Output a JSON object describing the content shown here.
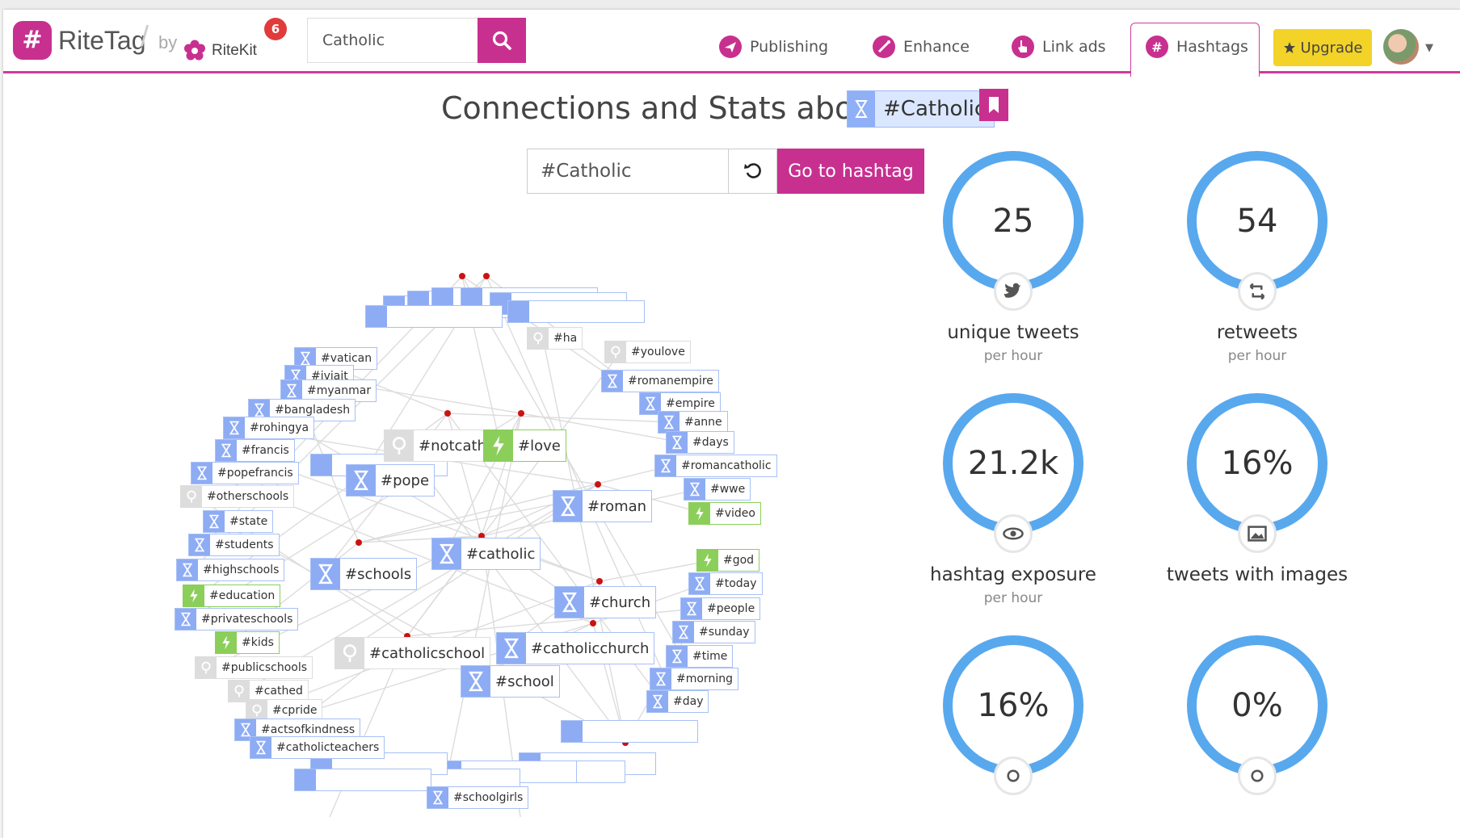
{
  "header": {
    "logo_mark": "#",
    "app_name": "RiteTag",
    "by_label": "by",
    "parent_name": "RiteKit",
    "notification_count": "6",
    "search_value": "Catholic",
    "nav": [
      {
        "label": "Publishing",
        "icon": "paper-plane-icon"
      },
      {
        "label": "Enhance",
        "icon": "magic-wand-icon"
      },
      {
        "label": "Link ads",
        "icon": "pointer-icon"
      },
      {
        "label": "Hashtags",
        "icon": "hashtag-icon",
        "active": true
      }
    ],
    "upgrade_label": "Upgrade",
    "brand_color": "#c8308f"
  },
  "page": {
    "title": "Connections and Stats about",
    "hashtag": "#Catholic",
    "input_value": "#Catholic",
    "go_label": "Go to hashtag"
  },
  "graph": {
    "nodes": [
      {
        "label": "#vatican",
        "kind": "blue"
      },
      {
        "label": "#iviait",
        "kind": "blue"
      },
      {
        "label": "#myanmar",
        "kind": "blue"
      },
      {
        "label": "#bangladesh",
        "kind": "blue"
      },
      {
        "label": "#rohingya",
        "kind": "blue"
      },
      {
        "label": "#francis",
        "kind": "blue"
      },
      {
        "label": "#popefrancis",
        "kind": "blue"
      },
      {
        "label": "#otherschools",
        "kind": "gray"
      },
      {
        "label": "#state",
        "kind": "blue"
      },
      {
        "label": "#students",
        "kind": "blue"
      },
      {
        "label": "#highschools",
        "kind": "blue"
      },
      {
        "label": "#education",
        "kind": "green"
      },
      {
        "label": "#privateschools",
        "kind": "blue"
      },
      {
        "label": "#kids",
        "kind": "green"
      },
      {
        "label": "#publicschools",
        "kind": "gray"
      },
      {
        "label": "#cathed",
        "kind": "gray"
      },
      {
        "label": "#cpride",
        "kind": "gray"
      },
      {
        "label": "#actsofkindness",
        "kind": "blue"
      },
      {
        "label": "#catholicteachers",
        "kind": "blue"
      },
      {
        "label": "#notcatho",
        "kind": "gray"
      },
      {
        "label": "#love",
        "kind": "green"
      },
      {
        "label": "#pope",
        "kind": "blue"
      },
      {
        "label": "#schools",
        "kind": "blue"
      },
      {
        "label": "#catholic",
        "kind": "blue"
      },
      {
        "label": "#roman",
        "kind": "blue"
      },
      {
        "label": "#church",
        "kind": "blue"
      },
      {
        "label": "#catholicschool",
        "kind": "gray"
      },
      {
        "label": "#catholicchurch",
        "kind": "blue"
      },
      {
        "label": "#school",
        "kind": "blue"
      },
      {
        "label": "#youlove",
        "kind": "gray"
      },
      {
        "label": "#ha",
        "kind": "gray"
      },
      {
        "label": "#romanempire",
        "kind": "blue"
      },
      {
        "label": "#empire",
        "kind": "blue"
      },
      {
        "label": "#anne",
        "kind": "blue"
      },
      {
        "label": "#days",
        "kind": "blue"
      },
      {
        "label": "#romancatholic",
        "kind": "blue"
      },
      {
        "label": "#wwe",
        "kind": "blue"
      },
      {
        "label": "#video",
        "kind": "green"
      },
      {
        "label": "#god",
        "kind": "green"
      },
      {
        "label": "#today",
        "kind": "blue"
      },
      {
        "label": "#people",
        "kind": "blue"
      },
      {
        "label": "#sunday",
        "kind": "blue"
      },
      {
        "label": "#time",
        "kind": "blue"
      },
      {
        "label": "#morning",
        "kind": "blue"
      },
      {
        "label": "#day",
        "kind": "blue"
      },
      {
        "label": "#schoolgirls",
        "kind": "blue"
      }
    ]
  },
  "stats": [
    {
      "value": "25",
      "label": "unique tweets",
      "sub": "per hour",
      "icon": "twitter-bird-icon"
    },
    {
      "value": "54",
      "label": "retweets",
      "sub": "per hour",
      "icon": "retweet-icon"
    },
    {
      "value": "21.2k",
      "label": "hashtag exposure",
      "sub": "per hour",
      "icon": "eye-icon"
    },
    {
      "value": "16%",
      "label": "tweets with images",
      "sub": "",
      "icon": "image-icon"
    },
    {
      "value": "16%",
      "label": "",
      "sub": "",
      "icon": "link-icon"
    },
    {
      "value": "0%",
      "label": "",
      "sub": "",
      "icon": "mention-icon"
    }
  ],
  "colors": {
    "ring": "#58a8ee",
    "hashtag_blue": "#8eacf4",
    "hashtag_green": "#8bcf5a",
    "hashtag_gray": "#dddddd",
    "edge": "#dcdcdc",
    "hub_dot": "#cc1111"
  }
}
